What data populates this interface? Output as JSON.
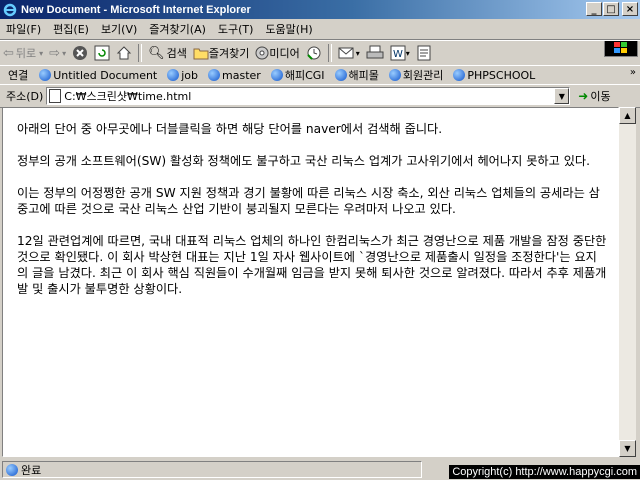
{
  "window": {
    "title": "New Document - Microsoft Internet Explorer"
  },
  "menu": [
    "파일(F)",
    "편집(E)",
    "보기(V)",
    "즐겨찾기(A)",
    "도구(T)",
    "도움말(H)"
  ],
  "toolbar": {
    "back": "뒤로",
    "search": "검색",
    "favorites": "즐겨찾기",
    "media": "미디어"
  },
  "links": {
    "label": "연결",
    "items": [
      "Untitled Document",
      "job",
      "master",
      "해피CGI",
      "해피몰",
      "회원관리",
      "PHPSCHOOL"
    ]
  },
  "address": {
    "label": "주소(D)",
    "value": "C:₩스크린샷₩time.html",
    "go": "이동"
  },
  "content": {
    "paragraphs": [
      "아래의 단어 중 아무곳에나 더블클릭을 하면 해당 단어를 naver에서 검색해 줍니다.",
      "정부의 공개 소프트웨어(SW) 활성화 정책에도 불구하고 국산 리눅스 업계가 고사위기에서 헤어나지 못하고 있다.",
      "이는 정부의 어정쩡한 공개 SW 지원 정책과 경기 불황에 따른 리눅스 시장 축소, 외산 리눅스 업체들의 공세라는 삼중고에 따른 것으로 국산 리눅스 산업 기반이 붕괴될지 모른다는 우려마저 나오고 있다.",
      "12일 관련업계에 따르면, 국내 대표적 리눅스 업체의 하나인 한컴리눅스가 최근 경영난으로 제품 개발을 잠정 중단한 것으로 확인됐다. 이 회사 박상현 대표는 지난 1일 자사 웹사이트에 `경영난으로 제품출시 일정을 조정한다'는 요지의 글을 남겼다. 최근 이 회사 핵심 직원들이 수개월째 임금을 받지 못해 퇴사한 것으로 알려졌다. 따라서 추후 제품개발 및 출시가 불투명한 상황이다."
    ]
  },
  "status": {
    "text": "완료",
    "copyright": "Copyright(c) http://www.happycgi.com"
  },
  "colors": {
    "titlebar_start": "#0a246a",
    "titlebar_end": "#a6caf0",
    "chrome": "#d4d0c8"
  }
}
